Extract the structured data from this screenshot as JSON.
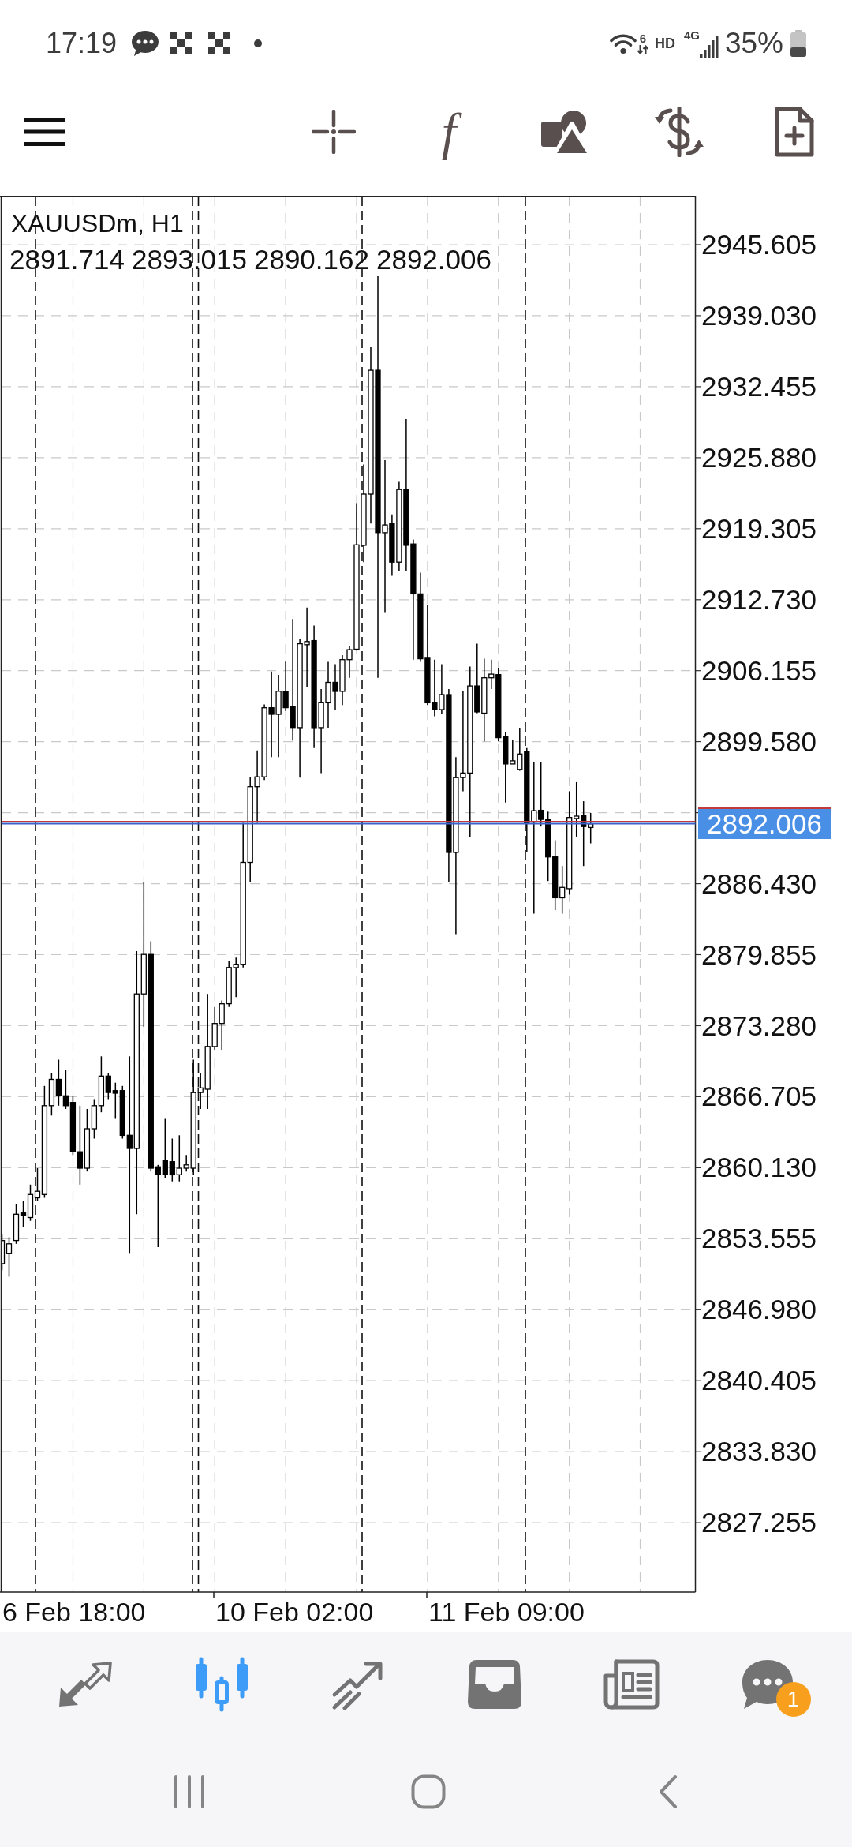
{
  "status_bar": {
    "time": "17:19",
    "wifi_badge": "6",
    "hd_label": "HD",
    "network_label": "4G",
    "battery": "35%"
  },
  "toolbar": {
    "indicator_glyph": "f"
  },
  "chart": {
    "symbol": "XAUUSDm, H1",
    "ohlc": [
      "2891.714",
      "2893.015",
      "2890.162",
      "2892.006"
    ],
    "price_axis": [
      "2945.605",
      "2939.030",
      "2932.455",
      "2925.880",
      "2919.305",
      "2912.730",
      "2906.155",
      "2899.580",
      "2886.430",
      "2879.855",
      "2873.280",
      "2866.705",
      "2860.130",
      "2853.555",
      "2846.980",
      "2840.405",
      "2833.830",
      "2827.255"
    ],
    "current_price": "2892.006",
    "time_axis": [
      "6 Feb 18:00",
      "10 Feb 02:00",
      "11 Feb 09:00"
    ]
  },
  "bottom_nav": {
    "items": [
      {
        "kind": "quotes",
        "selected": false
      },
      {
        "kind": "chart",
        "selected": true
      },
      {
        "kind": "trade",
        "selected": false
      },
      {
        "kind": "history",
        "selected": false
      },
      {
        "kind": "news",
        "selected": false
      },
      {
        "kind": "messages",
        "selected": false,
        "badge": "1"
      }
    ]
  }
}
